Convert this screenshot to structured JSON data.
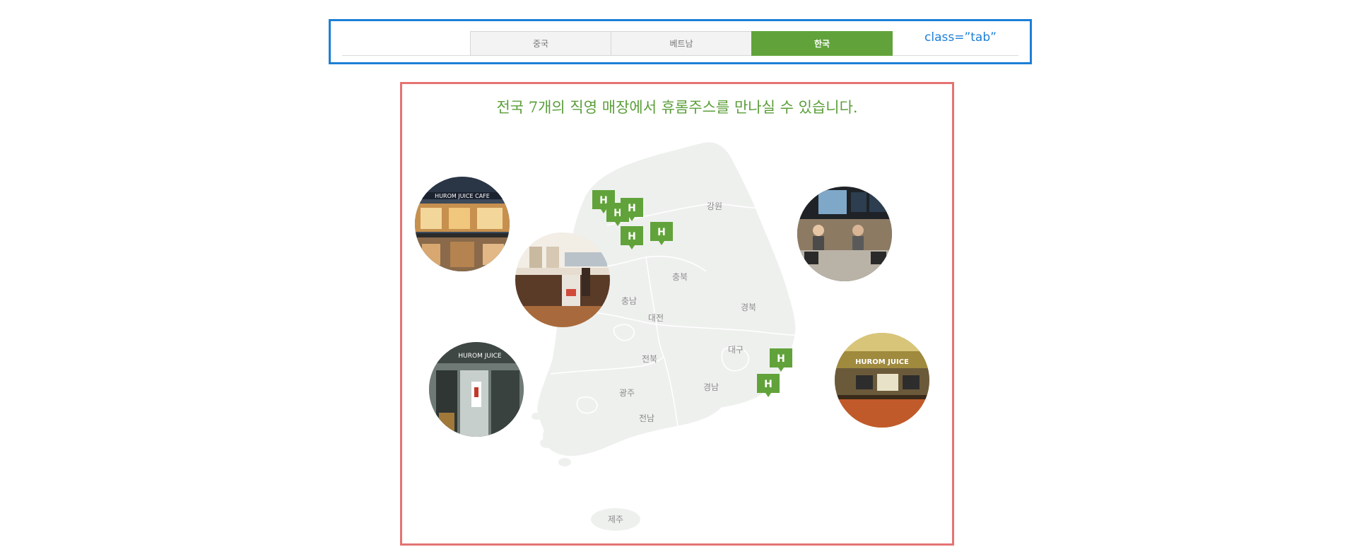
{
  "tabs": [
    {
      "label": "중국",
      "active": false
    },
    {
      "label": "베트남",
      "active": false
    },
    {
      "label": "한국",
      "active": true
    }
  ],
  "tab_annotation": "class=”tab”",
  "map": {
    "title": "전국 7개의 직영 매장에서 휴롬주스를 만나실 수 있습니다.",
    "regions": [
      "강원",
      "충북",
      "충남",
      "대전",
      "경북",
      "대구",
      "전북",
      "경남",
      "광주",
      "전남",
      "제주"
    ],
    "marker_label": "H",
    "stores": [
      {
        "name": "store-photo-1",
        "sign_text": "HUROM JUICE CAFE"
      },
      {
        "name": "store-photo-2",
        "sign_text": ""
      },
      {
        "name": "store-photo-3",
        "sign_text": "HUROM JUICE"
      },
      {
        "name": "store-photo-4",
        "sign_text": ""
      },
      {
        "name": "store-photo-5",
        "sign_text": "HUROM JUICE"
      }
    ]
  },
  "colors": {
    "accent_green": "#61a33a",
    "tab_outline": "#1d7fd6",
    "map_outline": "#e57373",
    "map_land": "#eef0ee"
  }
}
